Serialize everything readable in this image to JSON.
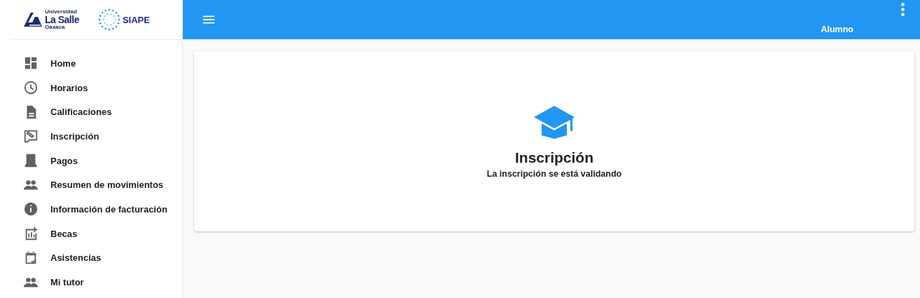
{
  "logos": {
    "university": {
      "top": "Universidad",
      "name": "La Salle",
      "campus": "Oaxaca"
    },
    "system": {
      "name": "SIAPE"
    }
  },
  "sidebar": {
    "items": [
      {
        "label": "Home"
      },
      {
        "label": "Horarios"
      },
      {
        "label": "Calificaciones"
      },
      {
        "label": "Inscripción"
      },
      {
        "label": "Pagos"
      },
      {
        "label": "Resumen de movimientos"
      },
      {
        "label": "Información de facturación"
      },
      {
        "label": "Becas"
      },
      {
        "label": "Asistencias"
      },
      {
        "label": "Mi tutor"
      }
    ]
  },
  "topbar": {
    "role": "Alumno"
  },
  "card": {
    "title": "Inscripción",
    "message": "La inscripción se está validando"
  }
}
